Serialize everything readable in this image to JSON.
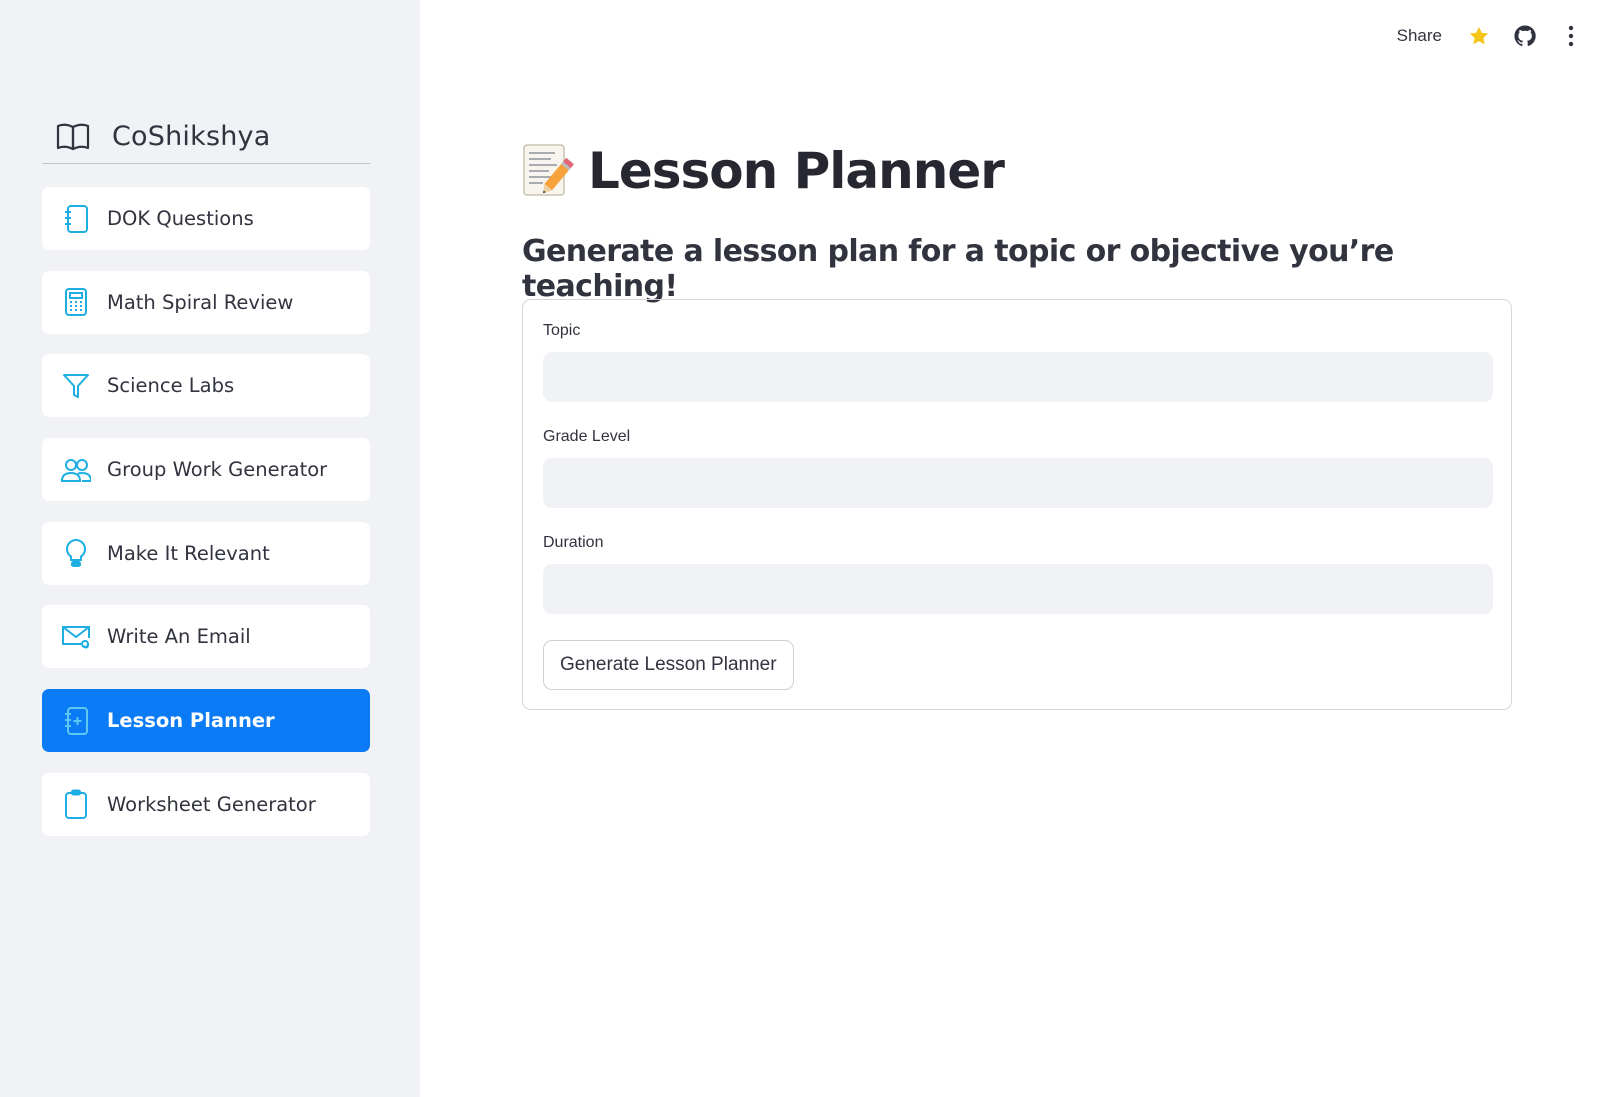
{
  "header": {
    "share_label": "Share",
    "icons": [
      "star-icon",
      "github-icon",
      "more-vertical-icon"
    ],
    "star_color": "#f5c518"
  },
  "sidebar": {
    "brand_title": "CoShikshya",
    "brand_icon": "book-open-icon",
    "accent_color": "#0b7bf5",
    "icon_color": "#1eaee3",
    "items": [
      {
        "label": "DOK Questions",
        "icon": "notebook-icon"
      },
      {
        "label": "Math Spiral Review",
        "icon": "calculator-icon"
      },
      {
        "label": "Science Labs",
        "icon": "funnel-icon"
      },
      {
        "label": "Group Work Generator",
        "icon": "people-icon"
      },
      {
        "label": "Make It Relevant",
        "icon": "lightbulb-icon"
      },
      {
        "label": "Write An Email",
        "icon": "email-icon"
      },
      {
        "label": "Lesson Planner",
        "icon": "journal-plus-icon",
        "active": true
      },
      {
        "label": "Worksheet Generator",
        "icon": "clipboard-icon"
      }
    ]
  },
  "main": {
    "title": "Lesson Planner",
    "title_emoji": "memo-icon",
    "subtitle": "Generate a lesson plan for a topic or objective you’re teaching!",
    "form": {
      "fields": [
        {
          "label": "Topic",
          "value": "",
          "placeholder": ""
        },
        {
          "label": "Grade Level",
          "value": "",
          "placeholder": ""
        },
        {
          "label": "Duration",
          "value": "",
          "placeholder": ""
        }
      ],
      "submit_label": "Generate Lesson Planner"
    }
  }
}
